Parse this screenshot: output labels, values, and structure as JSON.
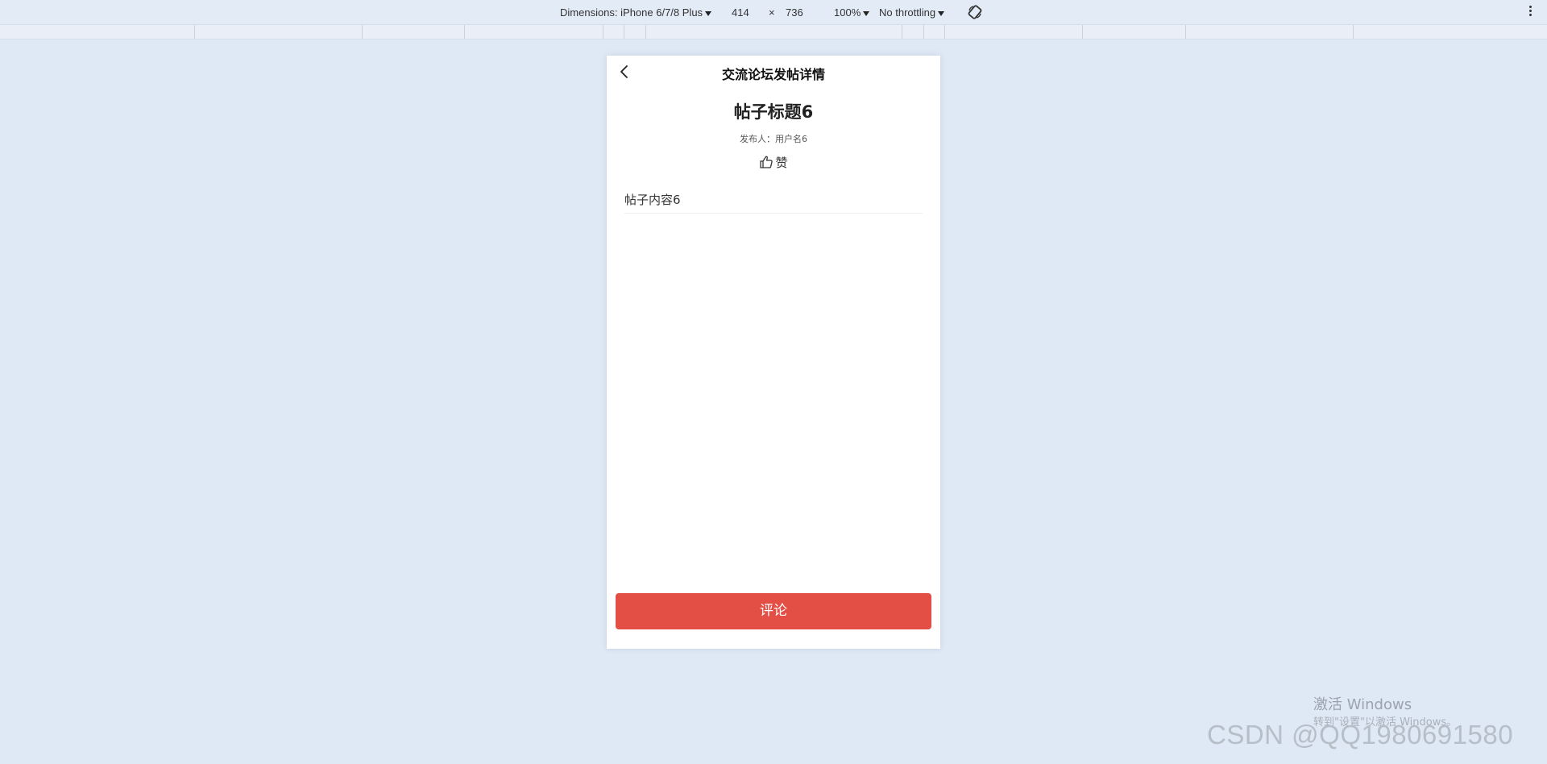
{
  "devtools": {
    "dimensions_label": "Dimensions: iPhone 6/7/8 Plus",
    "width_value": "414",
    "times": "×",
    "height_value": "736",
    "zoom": "100%",
    "throttling": "No throttling",
    "icons": [
      "rotate-icon",
      "more-options-icon"
    ]
  },
  "app": {
    "nav_title": "交流论坛发帖详情",
    "back_icon": "chevron-left-icon",
    "post": {
      "title": "帖子标题6",
      "author_line": "发布人：用户名6",
      "like_label": "赞",
      "like_icon": "thumbs-up-icon",
      "content": "帖子内容6"
    },
    "comment_button": "评论",
    "accent_color": "#e34e45"
  },
  "watermarks": {
    "windows_activate": "激活 Windows",
    "windows_activate_sub": "转到\"设置\"以激活 Windows。",
    "csdn": "CSDN @QQ1980691580"
  }
}
